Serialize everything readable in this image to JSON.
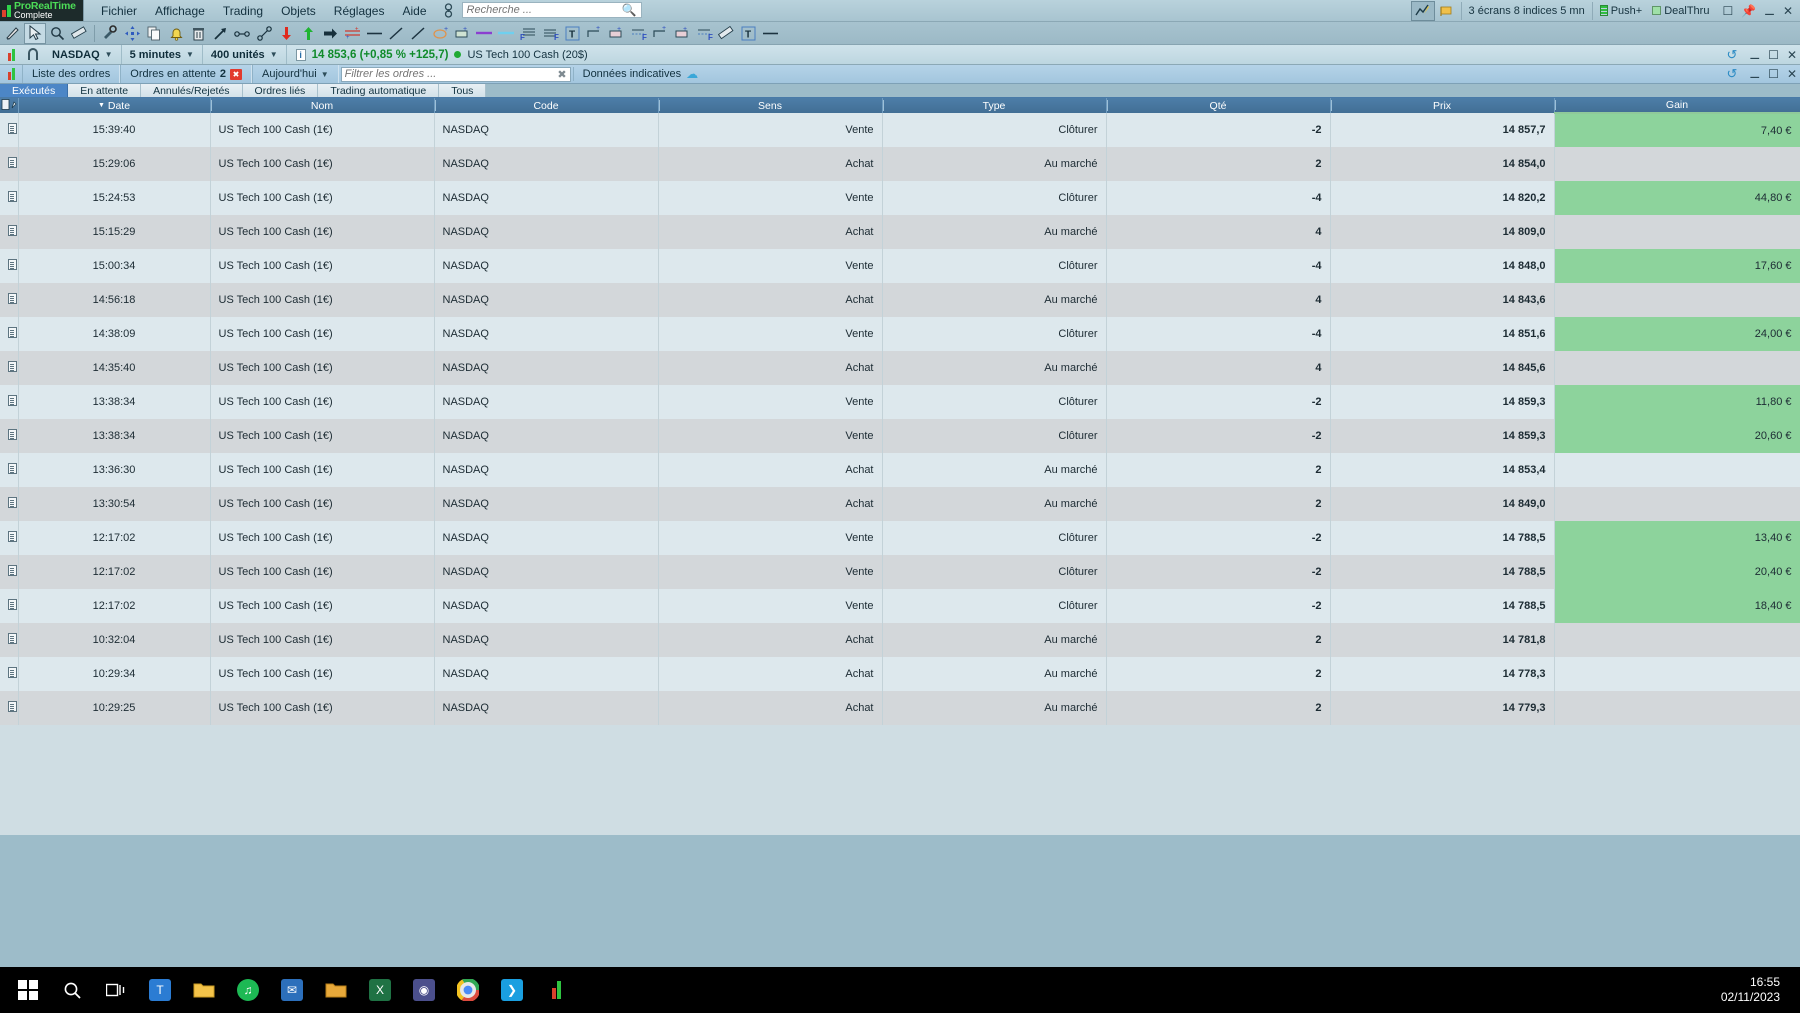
{
  "app": {
    "brand_line1": "ProRealTime",
    "brand_line2": "Complete"
  },
  "menu": {
    "items": [
      "Fichier",
      "Affichage",
      "Trading",
      "Objets",
      "Réglages",
      "Aide"
    ],
    "search_placeholder": "Recherche ...",
    "right": {
      "workspace_label": "3 écrans 8 indices 5 mn",
      "push_label": "Push+",
      "dealthru_label": "DealThru"
    }
  },
  "instrument_bar": {
    "market": "NASDAQ",
    "timeframe": "5 minutes",
    "units": "400 unités",
    "info_badge": "i",
    "price": "14 853,6 (+0,85 % +125,7)",
    "instrument": "US Tech 100 Cash (20$)"
  },
  "order_bar": {
    "orders_list": "Liste des ordres",
    "pending_orders": "Ordres en attente",
    "pending_count": "2",
    "period": "Aujourd'hui",
    "filter_placeholder": "Filtrer les ordres ...",
    "indicative_data": "Données indicatives"
  },
  "tabs": [
    {
      "label": "Exécutés",
      "active": true
    },
    {
      "label": "En attente",
      "active": false
    },
    {
      "label": "Annulés/Rejetés",
      "active": false
    },
    {
      "label": "Ordres liés",
      "active": false
    },
    {
      "label": "Trading automatique",
      "active": false
    },
    {
      "label": "Tous",
      "active": false
    }
  ],
  "table": {
    "columns": [
      "Date",
      "Nom",
      "Code",
      "Sens",
      "Type",
      "Qté",
      "Prix",
      "Gain"
    ],
    "sort_column": "Date",
    "sort_direction": "desc",
    "rows": [
      {
        "date": "15:39:40",
        "nom": "US Tech 100 Cash (1€)",
        "code": "NASDAQ",
        "sens": "Vente",
        "type": "Clôturer",
        "qte": "-2",
        "prix": "14 857,7",
        "gain": "7,40 €"
      },
      {
        "date": "15:29:06",
        "nom": "US Tech 100 Cash (1€)",
        "code": "NASDAQ",
        "sens": "Achat",
        "type": "Au marché",
        "qte": "2",
        "prix": "14 854,0",
        "gain": ""
      },
      {
        "date": "15:24:53",
        "nom": "US Tech 100 Cash (1€)",
        "code": "NASDAQ",
        "sens": "Vente",
        "type": "Clôturer",
        "qte": "-4",
        "prix": "14 820,2",
        "gain": "44,80 €"
      },
      {
        "date": "15:15:29",
        "nom": "US Tech 100 Cash (1€)",
        "code": "NASDAQ",
        "sens": "Achat",
        "type": "Au marché",
        "qte": "4",
        "prix": "14 809,0",
        "gain": ""
      },
      {
        "date": "15:00:34",
        "nom": "US Tech 100 Cash (1€)",
        "code": "NASDAQ",
        "sens": "Vente",
        "type": "Clôturer",
        "qte": "-4",
        "prix": "14 848,0",
        "gain": "17,60 €"
      },
      {
        "date": "14:56:18",
        "nom": "US Tech 100 Cash (1€)",
        "code": "NASDAQ",
        "sens": "Achat",
        "type": "Au marché",
        "qte": "4",
        "prix": "14 843,6",
        "gain": ""
      },
      {
        "date": "14:38:09",
        "nom": "US Tech 100 Cash (1€)",
        "code": "NASDAQ",
        "sens": "Vente",
        "type": "Clôturer",
        "qte": "-4",
        "prix": "14 851,6",
        "gain": "24,00 €"
      },
      {
        "date": "14:35:40",
        "nom": "US Tech 100 Cash (1€)",
        "code": "NASDAQ",
        "sens": "Achat",
        "type": "Au marché",
        "qte": "4",
        "prix": "14 845,6",
        "gain": ""
      },
      {
        "date": "13:38:34",
        "nom": "US Tech 100 Cash (1€)",
        "code": "NASDAQ",
        "sens": "Vente",
        "type": "Clôturer",
        "qte": "-2",
        "prix": "14 859,3",
        "gain": "11,80 €"
      },
      {
        "date": "13:38:34",
        "nom": "US Tech 100 Cash (1€)",
        "code": "NASDAQ",
        "sens": "Vente",
        "type": "Clôturer",
        "qte": "-2",
        "prix": "14 859,3",
        "gain": "20,60 €"
      },
      {
        "date": "13:36:30",
        "nom": "US Tech 100 Cash (1€)",
        "code": "NASDAQ",
        "sens": "Achat",
        "type": "Au marché",
        "qte": "2",
        "prix": "14 853,4",
        "gain": ""
      },
      {
        "date": "13:30:54",
        "nom": "US Tech 100 Cash (1€)",
        "code": "NASDAQ",
        "sens": "Achat",
        "type": "Au marché",
        "qte": "2",
        "prix": "14 849,0",
        "gain": ""
      },
      {
        "date": "12:17:02",
        "nom": "US Tech 100 Cash (1€)",
        "code": "NASDAQ",
        "sens": "Vente",
        "type": "Clôturer",
        "qte": "-2",
        "prix": "14 788,5",
        "gain": "13,40 €"
      },
      {
        "date": "12:17:02",
        "nom": "US Tech 100 Cash (1€)",
        "code": "NASDAQ",
        "sens": "Vente",
        "type": "Clôturer",
        "qte": "-2",
        "prix": "14 788,5",
        "gain": "20,40 €"
      },
      {
        "date": "12:17:02",
        "nom": "US Tech 100 Cash (1€)",
        "code": "NASDAQ",
        "sens": "Vente",
        "type": "Clôturer",
        "qte": "-2",
        "prix": "14 788,5",
        "gain": "18,40 €"
      },
      {
        "date": "10:32:04",
        "nom": "US Tech 100 Cash (1€)",
        "code": "NASDAQ",
        "sens": "Achat",
        "type": "Au marché",
        "qte": "2",
        "prix": "14 781,8",
        "gain": ""
      },
      {
        "date": "10:29:34",
        "nom": "US Tech 100 Cash (1€)",
        "code": "NASDAQ",
        "sens": "Achat",
        "type": "Au marché",
        "qte": "2",
        "prix": "14 778,3",
        "gain": ""
      },
      {
        "date": "10:29:25",
        "nom": "US Tech 100 Cash (1€)",
        "code": "NASDAQ",
        "sens": "Achat",
        "type": "Au marché",
        "qte": "2",
        "prix": "14 779,3",
        "gain": ""
      }
    ]
  },
  "taskbar": {
    "time": "16:55",
    "date": "02/11/2023"
  },
  "colors": {
    "accent_blue": "#4c86c6",
    "header_blue": "#4a7ba8",
    "gain_green": "#8dd39c",
    "sell_red": "#c92c22",
    "buy_green": "#157a24",
    "desktop": "#9dbcc9"
  }
}
